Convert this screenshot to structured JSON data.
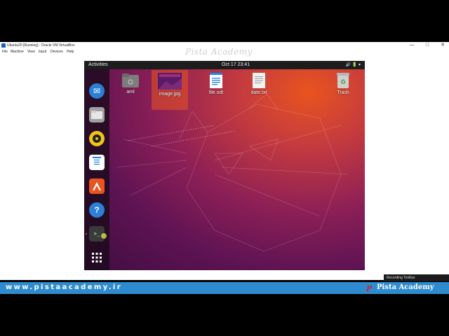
{
  "window": {
    "title": "Ubuntu20 [Running] - Oracle VM VirtualBox",
    "controls": {
      "minimize": "—",
      "maximize": "□",
      "close": "✕"
    },
    "menu": [
      "File",
      "Machine",
      "View",
      "Input",
      "Devices",
      "Help"
    ]
  },
  "watermark": "Pista Academy",
  "ubuntu": {
    "activities": "Activities",
    "clock": "Oct 17  23:41",
    "tray": "🔊 🔋 ▾",
    "dock": [
      {
        "name": "thunderbird-icon",
        "glyph": "✉",
        "color": "#2a7fd4"
      },
      {
        "name": "files-icon",
        "glyph": "▬",
        "color": "#9c9c9c"
      },
      {
        "name": "rhythmbox-icon",
        "glyph": "◉",
        "color": "#f0c419"
      },
      {
        "name": "writer-icon",
        "glyph": "≡",
        "color": "#1e88e5"
      },
      {
        "name": "software-icon",
        "glyph": "A",
        "color": "#e95420"
      },
      {
        "name": "help-icon",
        "glyph": "?",
        "color": "#2b80d8"
      },
      {
        "name": "terminal-icon",
        "glyph": ">_",
        "color": "#3a3a3a"
      },
      {
        "name": "apps-grid-icon",
        "glyph": "⋮⋮⋮",
        "color": "transparent"
      }
    ],
    "desktop": [
      {
        "label": "aml",
        "icon": "folder"
      },
      {
        "label": "image.jpg",
        "icon": "image"
      },
      {
        "label": "file.odt",
        "icon": "doc"
      },
      {
        "label": "date.txt",
        "icon": "txt"
      },
      {
        "label": "Trash",
        "icon": "trash"
      }
    ]
  },
  "footer": {
    "url": "www.pistaacademy.ir",
    "brand": "Pista Academy",
    "brand_logo": "P"
  },
  "recording_toolbar": "Recording Toolbar"
}
